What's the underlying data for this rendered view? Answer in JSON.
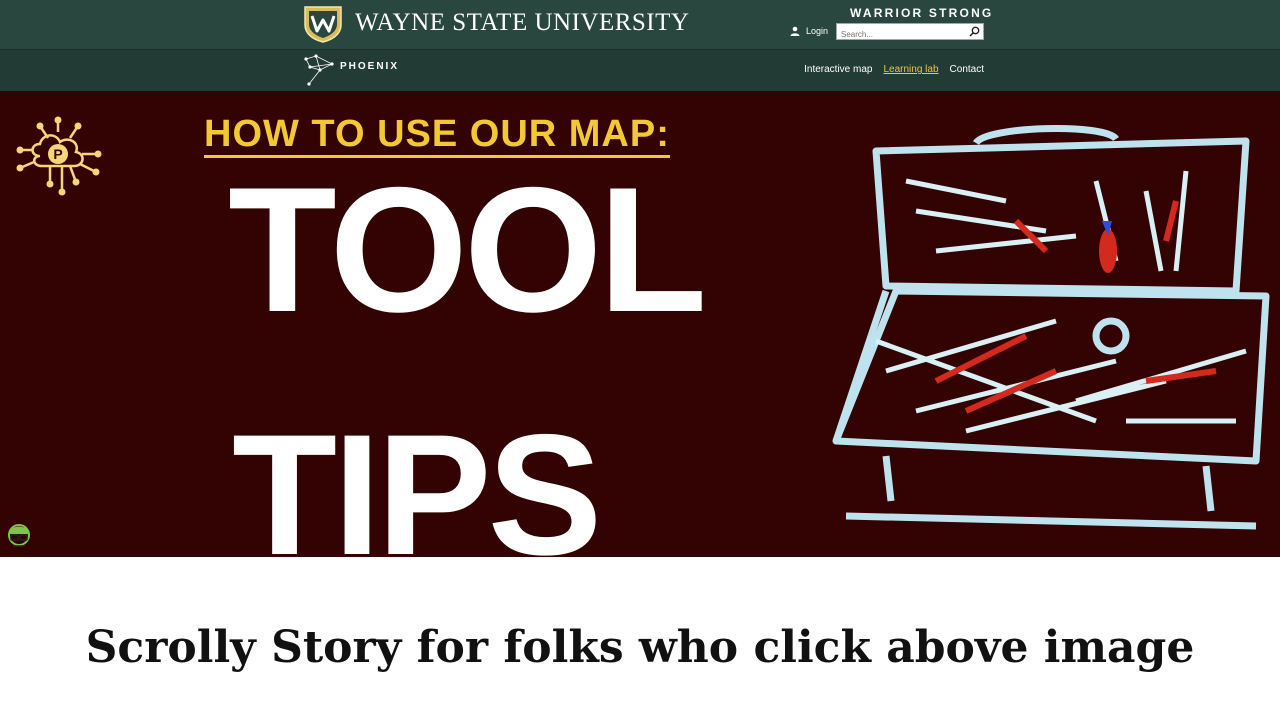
{
  "header": {
    "university_name": "WAYNE STATE UNIVERSITY",
    "tagline": "WARRIOR STRONG",
    "login_label": "Login",
    "search": {
      "placeholder": "Search..."
    }
  },
  "subsite": {
    "name": "PHOENIX",
    "nav": [
      {
        "label": "Interactive map",
        "active": false
      },
      {
        "label": "Learning lab",
        "active": true
      },
      {
        "label": "Contact",
        "active": false
      }
    ]
  },
  "hero": {
    "subtitle": "HOW TO USE OUR MAP:",
    "title_line1": "TOOL",
    "title_line2": "TIPS",
    "badge_letter": "P"
  },
  "caption": "Scrolly Story for folks who click above image",
  "colors": {
    "header_bg": "#29473f",
    "nav_bg": "#223b35",
    "hero_bg": "#330303",
    "accent_gold": "#f2c933",
    "active_link": "#e6c84a"
  },
  "icons": [
    "wayne-state-shield-icon",
    "user-icon",
    "search-icon",
    "phoenix-constellation-icon",
    "circuit-badge-icon",
    "avatar-icon",
    "toolbox-illustration"
  ]
}
